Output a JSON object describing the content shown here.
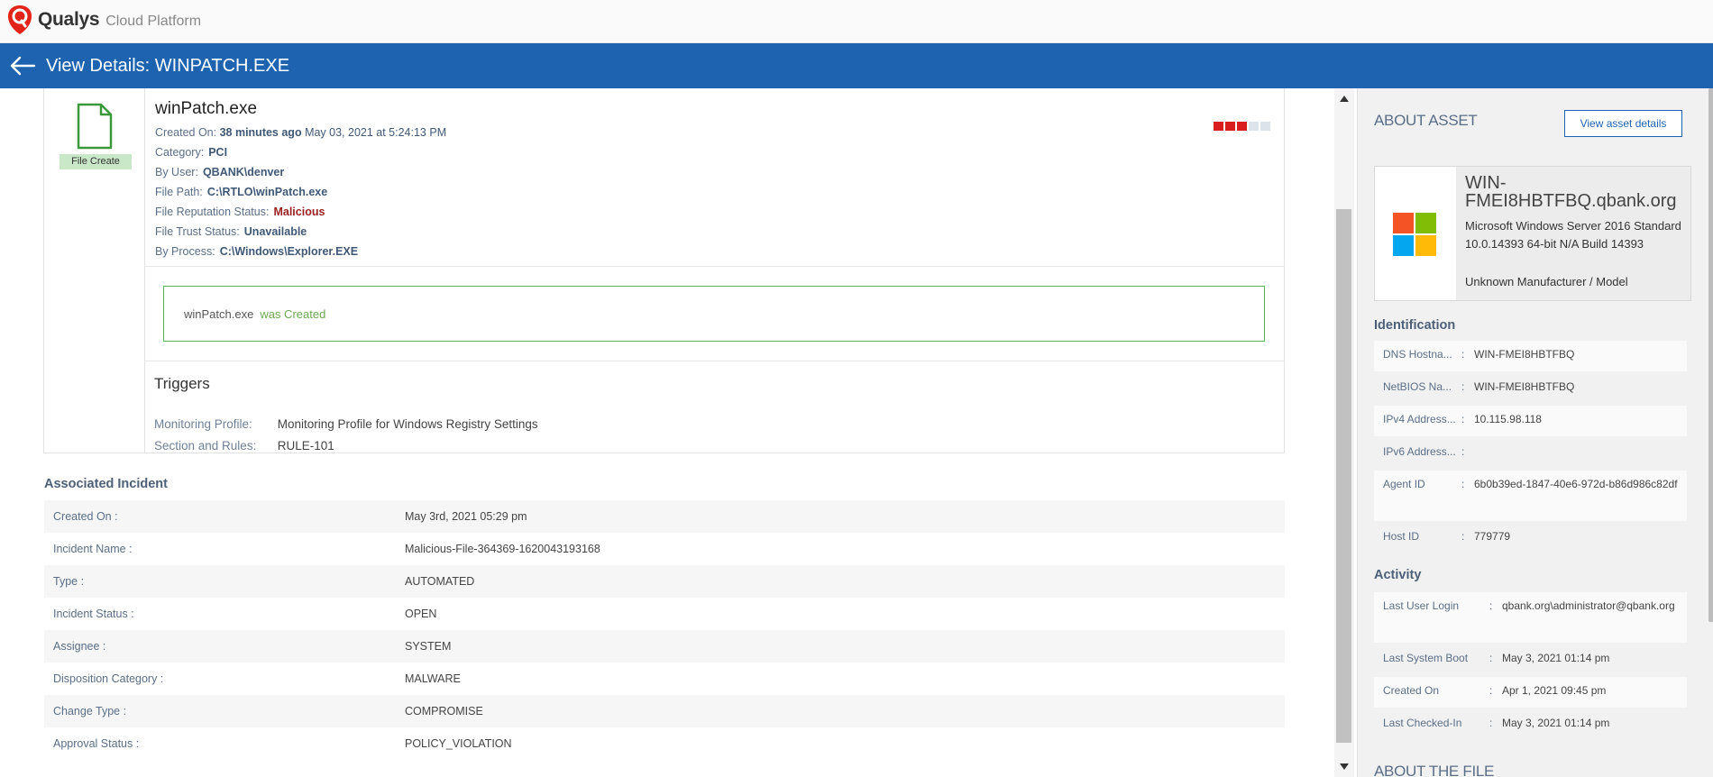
{
  "app": {
    "brand": "Qualys",
    "product": "Cloud Platform"
  },
  "header": {
    "title": "View Details: WINPATCH.EXE"
  },
  "file": {
    "badge": "File Create",
    "name": "winPatch.exe",
    "created_label": "Created On:",
    "created_rel": "38 minutes ago",
    "created_abs": "May 03, 2021 at 5:24:13 PM",
    "category_label": "Category:",
    "category": "PCI",
    "user_label": "By User:",
    "user": "QBANK\\denver",
    "path_label": "File Path:",
    "path": "C:\\RTLO\\winPatch.exe",
    "reputation_label": "File Reputation Status:",
    "reputation": "Malicious",
    "trust_label": "File Trust Status:",
    "trust": "Unavailable",
    "process_label": "By Process:",
    "process": "C:\\Windows\\Explorer.EXE",
    "severity_level": 3,
    "severity_max": 5,
    "severity_color": "#d81e1e"
  },
  "event": {
    "file": "winPatch.exe",
    "action": "was Created"
  },
  "triggers": {
    "title": "Triggers",
    "profile_label": "Monitoring Profile:",
    "profile": "Monitoring Profile for Windows Registry Settings",
    "rules_label": "Section and Rules:",
    "rules": "RULE-101"
  },
  "incident": {
    "title": "Associated Incident",
    "rows": [
      {
        "label": "Created On",
        "value": "May 3rd, 2021 05:29 pm"
      },
      {
        "label": "Incident Name",
        "value": "Malicious-File-364369-1620043193168"
      },
      {
        "label": "Type",
        "value": "AUTOMATED"
      },
      {
        "label": "Incident Status",
        "value": "OPEN"
      },
      {
        "label": "Assignee",
        "value": "SYSTEM"
      },
      {
        "label": "Disposition Category",
        "value": "MALWARE"
      },
      {
        "label": "Change Type",
        "value": "COMPROMISE"
      },
      {
        "label": "Approval Status",
        "value": "POLICY_VIOLATION"
      }
    ]
  },
  "asset": {
    "title": "ABOUT ASSET",
    "view_button": "View asset details",
    "hostname": "WIN-FMEI8HBTFBQ.qbank.org",
    "os": "Microsoft Windows Server 2016 Standard 10.0.14393 64-bit N/A Build 14393",
    "manufacturer": "Unknown Manufacturer / Model",
    "identification_title": "Identification",
    "identification": [
      {
        "label": "DNS Hostna...",
        "value": "WIN-FMEI8HBTFBQ"
      },
      {
        "label": "NetBIOS Na...",
        "value": "WIN-FMEI8HBTFBQ"
      },
      {
        "label": "IPv4 Address...",
        "value": "10.115.98.118"
      },
      {
        "label": "IPv6 Address...",
        "value": ""
      },
      {
        "label": "Agent ID",
        "value": "6b0b39ed-1847-40e6-972d-b86d986c82df"
      },
      {
        "label": "Host ID",
        "value": "779779"
      }
    ],
    "activity_title": "Activity",
    "activity": [
      {
        "label": "Last User Login",
        "value": "qbank.org\\administrator@qbank.org"
      },
      {
        "label": "Last System Boot",
        "value": "May 3, 2021 01:14 pm"
      },
      {
        "label": "Created On",
        "value": "Apr 1, 2021 09:45 pm"
      },
      {
        "label": "Last Checked-In",
        "value": "May 3, 2021 01:14 pm"
      }
    ]
  },
  "about_file": {
    "title": "ABOUT THE FILE"
  },
  "colors": {
    "primary": "#1d63b0",
    "brand_red": "#e2231a",
    "success": "#5cb35c",
    "malicious": "#9b1f1f"
  }
}
